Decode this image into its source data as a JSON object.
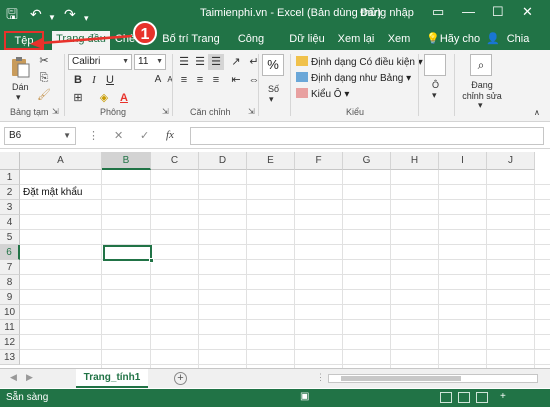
{
  "window": {
    "title": "Taimienphi.vn - Excel (Bản dùng thử)",
    "login": "Đăng nhập",
    "accent": "#217346"
  },
  "tabs": [
    {
      "label": "Tệp",
      "active": false
    },
    {
      "label": "Trang đầu",
      "active": true
    },
    {
      "label": "Chè",
      "active": false
    },
    {
      "label": "Bố trí Trang",
      "active": false
    },
    {
      "label": "Công thức",
      "active": false
    },
    {
      "label": "Dữ liệu",
      "active": false
    },
    {
      "label": "Xem lại",
      "active": false
    },
    {
      "label": "Xem",
      "active": false
    },
    {
      "label": "Hãy cho t",
      "active": false
    },
    {
      "label": "Chia sẻ",
      "active": false
    }
  ],
  "ribbon": {
    "paste_label": "Dán",
    "font_name": "Calibri",
    "font_size": "11",
    "groups": {
      "clipboard": "Bảng tạm",
      "font": "Phông",
      "alignment": "Căn chỉnh",
      "styles": "Kiểu",
      "number": "%"
    },
    "number_label": "Số",
    "styles_items": [
      "Định dạng Có điều kiện",
      "Định dạng như Bảng",
      "Kiểu Ô"
    ],
    "cells_label": "Ô",
    "editing_label": "Đang chỉnh sửa"
  },
  "formula_bar": {
    "name_box": "B6",
    "formula": ""
  },
  "grid": {
    "columns": [
      "A",
      "B",
      "C",
      "D",
      "E",
      "F",
      "G",
      "H",
      "I",
      "J"
    ],
    "rows": [
      "1",
      "2",
      "3",
      "4",
      "5",
      "6",
      "7",
      "8",
      "9",
      "10",
      "11",
      "12",
      "13"
    ],
    "selected_column": "B",
    "selected_row": "6",
    "cell_A2": "Đặt mật khẩu"
  },
  "sheets": [
    {
      "name": "Trang_tính1",
      "active": true
    }
  ],
  "status": {
    "ready": "Sẵn sàng",
    "zoom": "+"
  },
  "annotation": {
    "step": "1",
    "color": "#e8322b"
  }
}
